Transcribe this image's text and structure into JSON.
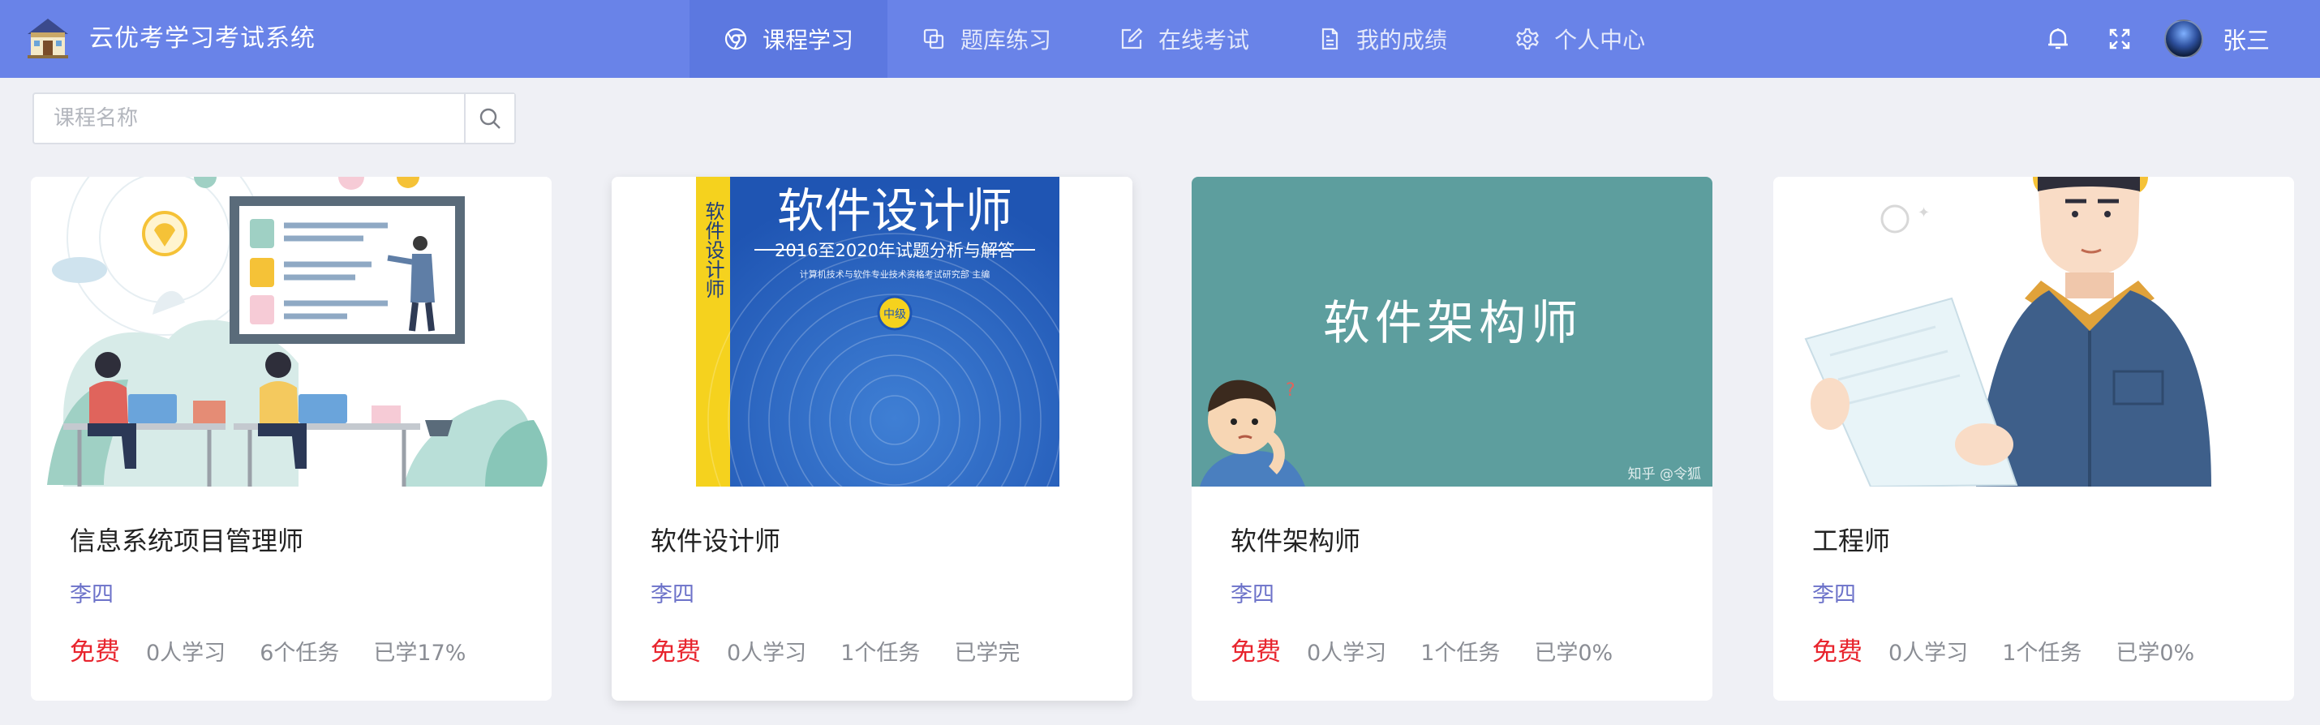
{
  "app": {
    "title": "云优考学习考试系统"
  },
  "nav": [
    {
      "label": "课程学习",
      "icon": "course-icon",
      "active": true
    },
    {
      "label": "题库练习",
      "icon": "question-bank-icon",
      "active": false
    },
    {
      "label": "在线考试",
      "icon": "exam-edit-icon",
      "active": false
    },
    {
      "label": "我的成绩",
      "icon": "report-icon",
      "active": false
    },
    {
      "label": "个人中心",
      "icon": "gear-icon",
      "active": false
    }
  ],
  "user": {
    "name": "张三"
  },
  "search": {
    "placeholder": "课程名称",
    "value": ""
  },
  "colors": {
    "topbar": "#6983e8",
    "active_tab": "#5c78e0",
    "price": "#e8242d",
    "teacher": "#6c72c9"
  },
  "cover_texts": {
    "book_title": "软件设计师",
    "book_subtitle": "2016至2020年试题分析与解答",
    "book_editor": "计算机技术与软件专业技术资格考试研究部 主编",
    "book_badge": "中级",
    "book_spine": "软件设计师",
    "architect_banner": "软件架构师",
    "watermark": "知乎 @令狐"
  },
  "courses": [
    {
      "title": "信息系统项目管理师",
      "teacher": "李四",
      "price": "免费",
      "learners": "0人学习",
      "tasks": "6个任务",
      "progress": "已学17%"
    },
    {
      "title": "软件设计师",
      "teacher": "李四",
      "price": "免费",
      "learners": "0人学习",
      "tasks": "1个任务",
      "progress": "已学完"
    },
    {
      "title": "软件架构师",
      "teacher": "李四",
      "price": "免费",
      "learners": "0人学习",
      "tasks": "1个任务",
      "progress": "已学0%"
    },
    {
      "title": "工程师",
      "teacher": "李四",
      "price": "免费",
      "learners": "0人学习",
      "tasks": "1个任务",
      "progress": "已学0%"
    }
  ]
}
